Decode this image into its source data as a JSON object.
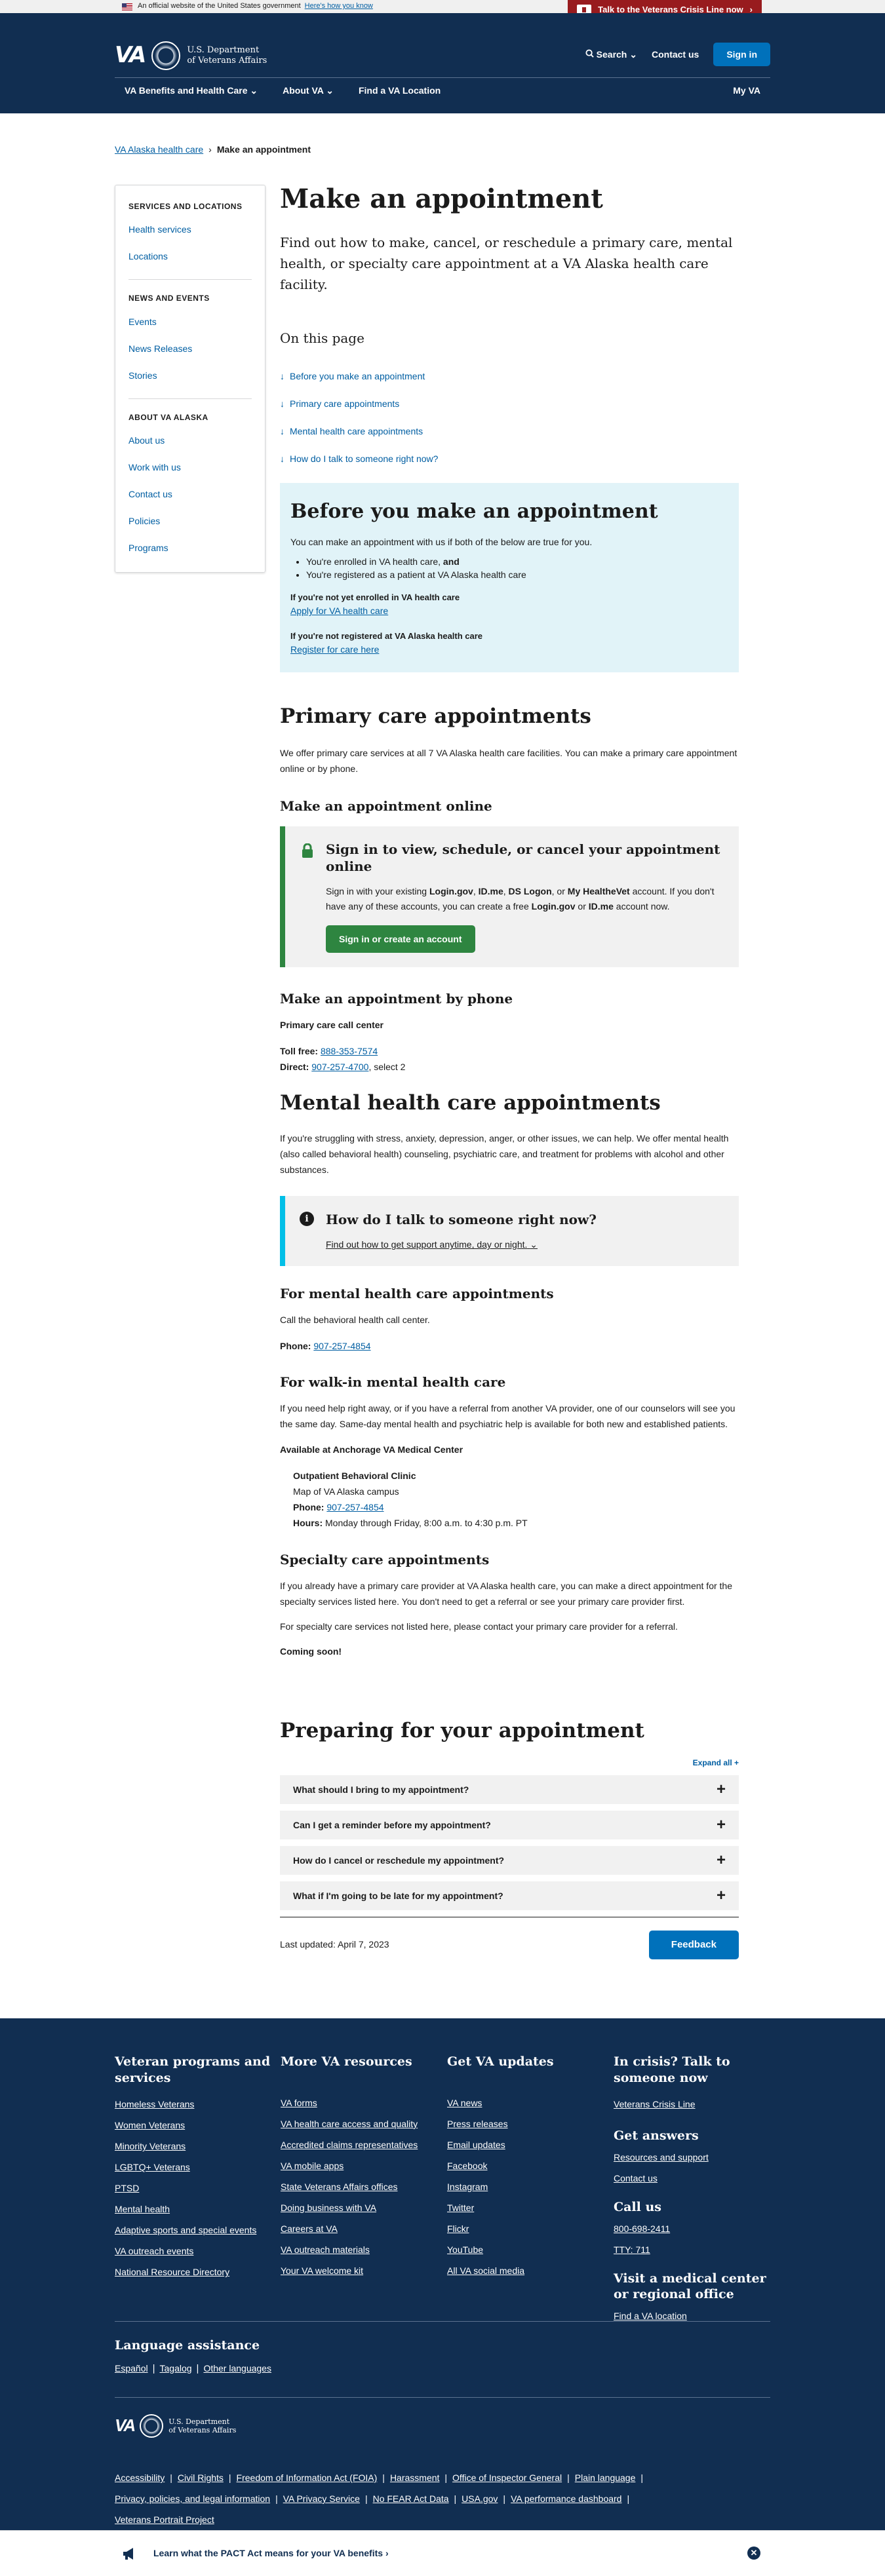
{
  "banner": {
    "text": "An official website of the United States government",
    "link": "Here's how you know"
  },
  "crisis_line": {
    "label": "Talk to the Veterans Crisis Line now"
  },
  "header": {
    "logo_text": "VA",
    "dept_line1": "U.S. Department",
    "dept_line2": "of Veterans Affairs",
    "search": "Search",
    "contact": "Contact us",
    "signin": "Sign in",
    "nav": [
      "VA Benefits and Health Care",
      "About VA",
      "Find a VA Location"
    ],
    "myva": "My VA"
  },
  "breadcrumb": {
    "parent": "VA Alaska health care",
    "current": "Make an appointment"
  },
  "sidebar": {
    "sections": [
      {
        "heading": "SERVICES AND LOCATIONS",
        "items": [
          "Health services",
          "Locations"
        ]
      },
      {
        "heading": "NEWS AND EVENTS",
        "items": [
          "Events",
          "News Releases",
          "Stories"
        ]
      },
      {
        "heading": "ABOUT VA ALASKA",
        "items": [
          "About us",
          "Work with us",
          "Contact us",
          "Policies",
          "Programs"
        ]
      }
    ]
  },
  "main": {
    "title": "Make an appointment",
    "intro": "Find out how to make, cancel, or reschedule a primary care, mental health, or specialty care appointment at a VA Alaska health care facility.",
    "on_this_page": "On this page",
    "otp_links": [
      "Before you make an appointment",
      "Primary care appointments",
      "Mental health care appointments",
      "How do I talk to someone right now?",
      "Preparing for your appointment"
    ],
    "before": {
      "heading": "Before you make an appointment",
      "text": "You can make an appointment with us if both of the below are true for you.",
      "li1": "You're enrolled in VA health care,",
      "li1_and": " and",
      "li2": "You're registered as a patient at VA Alaska health care",
      "h1": "If you're not yet enrolled in VA health care",
      "a1": "Apply for VA health care",
      "h2": "If you're not registered at VA Alaska health care",
      "a2": "Register for care here"
    },
    "primary": {
      "heading": "Primary care appointments",
      "text": "We offer primary care services at all 7 VA Alaska health care facilities. You can make a primary care appointment online or by phone.",
      "online_heading": "Make an appointment online",
      "signin_heading": "Sign in to view, schedule, or cancel your appointment online",
      "signin_t1": "Sign in with your existing ",
      "signin_b1": "Login.gov",
      "signin_t2": ", ",
      "signin_b2": "ID.me",
      "signin_t3": ", ",
      "signin_b3": "DS Logon",
      "signin_t4": ", or ",
      "signin_b4": "My HealtheVet",
      "signin_t5": " account. If you don't have any of these accounts, you can create a free ",
      "signin_b5": "Login.gov",
      "signin_t6": " or ",
      "signin_b6": "ID.me",
      "signin_t7": " account now.",
      "signin_btn": "Sign in or create an account",
      "phone_heading": "Make an appointment by phone",
      "call_center": "Primary care call center",
      "tollfree_label": "Toll free:",
      "tollfree": "888-353-7574",
      "direct_label": "Direct:",
      "direct": "907-257-4700",
      "direct_suffix": ", select 2"
    },
    "mental": {
      "heading": "Mental health care appointments",
      "text": "If you're struggling with stress, anxiety, depression, anger, or other issues, we can help. We offer mental health (also called behavioral health) counseling, psychiatric care, and treatment for problems with alcohol and other substances.",
      "talk_heading": "How do I talk to someone right now?",
      "talk_link": "Find out how to get support anytime, day or night.",
      "appt_heading": "For mental health care appointments",
      "appt_text": "Call the behavioral health call center.",
      "phone_label": "Phone:",
      "phone": "907-257-4854",
      "walkin_heading": "For walk-in mental health care",
      "walkin_text": "If you need help right away, or if you have a referral from another VA provider, one of our counselors will see you the same day. Same-day mental health and psychiatric help is available for both new and established patients.",
      "available": "Available at Anchorage VA Medical Center",
      "clinic": "Outpatient Behavioral Clinic",
      "map": "Map of VA Alaska campus",
      "clinic_phone_label": "Phone:",
      "clinic_phone": "907-257-4854",
      "hours_label": "Hours:",
      "hours": "Monday through Friday, 8:00 a.m. to 4:30 p.m. PT"
    },
    "specialty": {
      "heading": "Specialty care appointments",
      "text1": "If you already have a primary care provider at VA Alaska health care, you can make a direct appointment for the specialty services listed here. You don't need to get a referral or see your primary care provider first.",
      "text2": "For specialty care services not listed here, please contact your primary care provider for a referral.",
      "soon": "Coming soon!"
    },
    "preparing": {
      "heading": "Preparing for your appointment",
      "expand": "Expand all +",
      "questions": [
        "What should I bring to my appointment?",
        "Can I get a reminder before my appointment?",
        "How do I cancel or reschedule my appointment?",
        "What if I'm going to be late for my appointment?"
      ]
    },
    "last_updated": "Last updated: April 7, 2023",
    "feedback": "Feedback"
  },
  "footer": {
    "col1": {
      "heading": "Veteran programs and services",
      "links": [
        "Homeless Veterans",
        "Women Veterans",
        "Minority Veterans",
        "LGBTQ+ Veterans",
        "PTSD",
        "Mental health",
        "Adaptive sports and special events",
        "VA outreach events",
        "National Resource Directory"
      ]
    },
    "col2": {
      "heading": "More VA resources",
      "links": [
        "VA forms",
        "VA health care access and quality",
        "Accredited claims representatives",
        "VA mobile apps",
        "State Veterans Affairs offices",
        "Doing business with VA",
        "Careers at VA",
        "VA outreach materials",
        "Your VA welcome kit"
      ]
    },
    "col3": {
      "heading": "Get VA updates",
      "links": [
        "VA news",
        "Press releases",
        "Email updates",
        "Facebook",
        "Instagram",
        "Twitter",
        "Flickr",
        "YouTube",
        "All VA social media"
      ]
    },
    "col4": {
      "crisis_heading": "In crisis? Talk to someone now",
      "crisis_link": "Veterans Crisis Line",
      "answers_heading": "Get answers",
      "answers_links": [
        "Resources and support",
        "Contact us"
      ],
      "call_heading": "Call us",
      "call_links": [
        "800-698-2411",
        "TTY: 711"
      ],
      "visit_heading": "Visit a medical center or regional office",
      "visit_link": "Find a VA location"
    },
    "language": {
      "heading": "Language assistance",
      "links": [
        "Español",
        "Tagalog",
        "Other languages"
      ]
    },
    "bottom_links": [
      "Accessibility",
      "Civil Rights",
      "Freedom of Information Act (FOIA)",
      "Harassment",
      "Office of Inspector General",
      "Plain language",
      "Privacy, policies, and legal information",
      "VA Privacy Service",
      "No FEAR Act Data",
      "USA.gov",
      "VA performance dashboard",
      "Veterans Portrait Project"
    ]
  },
  "pact": {
    "text": "Learn what the PACT Act means for your VA benefits"
  }
}
